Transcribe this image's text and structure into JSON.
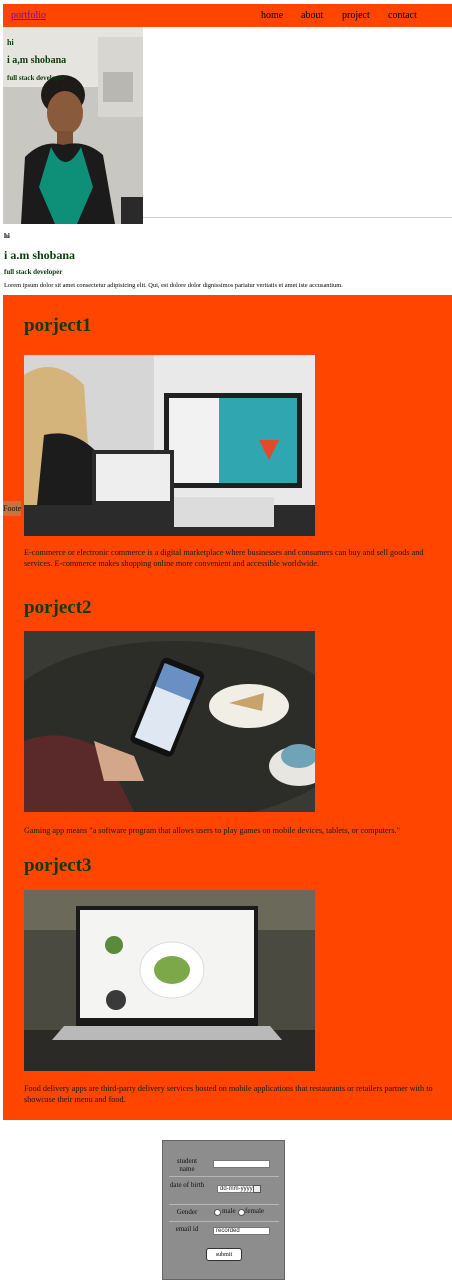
{
  "nav": {
    "brand": "portfolio",
    "links": [
      "home",
      "about",
      "project",
      "contact"
    ]
  },
  "hero": {
    "hi": "hi",
    "name": "i a,m shobana",
    "role": "full stack developer"
  },
  "intro": {
    "hi": "hi",
    "name": "i a.m shobana",
    "role": "full stack developer",
    "lorem": "Lorem ipsum dolor sit amet consectetur adipisicing elit. Qui, est dolore dolor dignissimos pariatur veritatis et amet iste accusantium."
  },
  "footer_tab": "Footer",
  "projects": [
    {
      "title": "porject1",
      "description": "E-commerce or electronic commerce is a digital marketplace where businesses and consumers can buy and sell goods and services. E-commerce makes shopping online more convenient and accessible worldwide."
    },
    {
      "title": "porject2",
      "description": "Gaming app means \"a software program that allows users to play games on mobile devices, tablets, or computers.\""
    },
    {
      "title": "porject3",
      "description": "Food delivery apps are third-party delivery services hosted on mobile applications that restaurants or retailers partner with to showcase their menu and food."
    }
  ],
  "form": {
    "student_name_label": "student name",
    "student_name_value": "",
    "dob_label": "date of birth",
    "dob_placeholder": "dd-mm-yyyy",
    "gender_label": "Gender",
    "gender_options": [
      "male",
      "female"
    ],
    "email_label": "email id",
    "email_value": "recorded",
    "submit_label": "submit"
  }
}
